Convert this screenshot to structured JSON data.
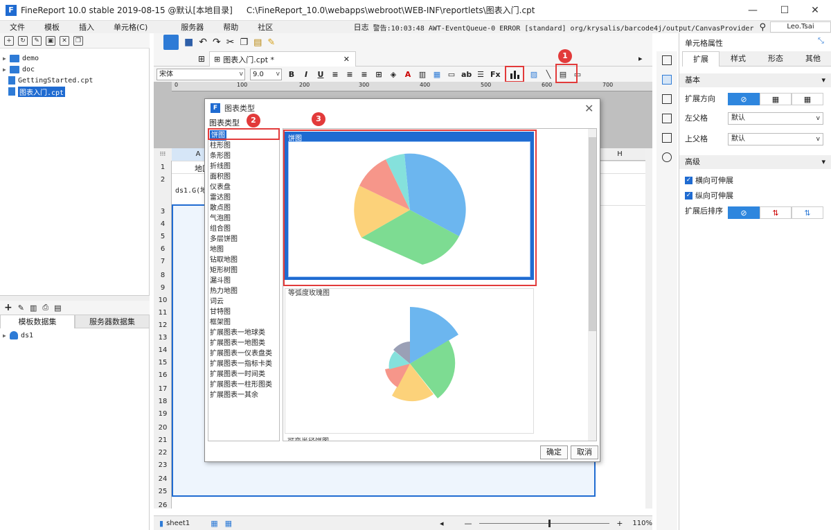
{
  "window": {
    "app_title": "FineReport 10.0 stable 2019-08-15 @默认[本地目录]",
    "path": "C:\\FineReport_10.0\\webapps\\webroot\\WEB-INF\\reportlets\\图表入门.cpt",
    "minimize": "—",
    "maximize": "☐",
    "close": "✕"
  },
  "menu": {
    "items": [
      "文件",
      "模板",
      "插入",
      "单元格(C)",
      "服务器",
      "帮助",
      "社区"
    ],
    "log_label": "日志",
    "warning": "警告:10:03:48 AWT-EventQueue-0 ERROR [standard] org/krysalis/barcode4j/output/CanvasProvider",
    "user": "Leo.Tsai"
  },
  "filetree": {
    "items": [
      {
        "label": "demo",
        "type": "folder"
      },
      {
        "label": "doc",
        "type": "folder"
      },
      {
        "label": "GettingStarted.cpt",
        "type": "file"
      },
      {
        "label": "图表入门.cpt",
        "type": "file",
        "selected": true
      }
    ]
  },
  "datasets": {
    "tabs": [
      "模板数据集",
      "服务器数据集"
    ],
    "items": [
      "ds1"
    ]
  },
  "doc_tab": {
    "label": "图表入门.cpt *",
    "close": "✕"
  },
  "format_bar": {
    "font": "宋体",
    "size": "9.0"
  },
  "ruler": {
    "ticks": [
      "0",
      "100",
      "200",
      "300",
      "400",
      "500",
      "600",
      "700"
    ]
  },
  "sheet": {
    "col_a": "A",
    "col_h": "H",
    "rows": [
      "1",
      "2",
      "3",
      "4",
      "5",
      "6",
      "7",
      "8",
      "9",
      "10",
      "11",
      "12",
      "13",
      "14",
      "15",
      "16",
      "17",
      "18",
      "19",
      "20",
      "21",
      "22",
      "23",
      "24",
      "25",
      "26"
    ],
    "cell_b1": "地区",
    "cell_a2": "ds1.G(地",
    "sheet_tab": "sheet1",
    "zoom": "110%"
  },
  "right_panel": {
    "title": "单元格属性",
    "tabs": [
      "扩展",
      "样式",
      "形态",
      "其他"
    ],
    "section_basic": "基本",
    "expand_dir": "扩展方向",
    "left_parent": "左父格",
    "left_parent_val": "默认",
    "up_parent": "上父格",
    "up_parent_val": "默认",
    "section_advanced": "高级",
    "h_expand": "横向可伸展",
    "v_expand": "纵向可伸展",
    "sort_after": "扩展后排序"
  },
  "dialog": {
    "title": "图表类型",
    "list_label": "图表类型",
    "types": [
      "饼图",
      "柱形图",
      "条形图",
      "折线图",
      "面积图",
      "仪表盘",
      "雷达图",
      "散点图",
      "气泡图",
      "组合图",
      "多层饼图",
      "地图",
      "钻取地图",
      "矩形树图",
      "漏斗图",
      "热力地图",
      "词云",
      "甘特图",
      "框架图",
      "扩展图表一地球类",
      "扩展图表一地图类",
      "扩展图表一仪表盘类",
      "扩展图表一指标卡类",
      "扩展图表一时间类",
      "扩展图表一柱形图类",
      "扩展图表一其余"
    ],
    "card1_label": "饼图",
    "card2_label": "等弧度玫瑰图",
    "card3_label": "可变半径饼图",
    "ok": "确定",
    "cancel": "取消"
  },
  "badges": [
    "1",
    "2",
    "3"
  ],
  "colors": {
    "accent": "#1f6bd1",
    "highlight_red": "#e23a3a",
    "pie_blue": "#5dade2",
    "pie_green": "#7ddc92",
    "pie_yellow": "#fcd27a",
    "pie_red": "#f48b7f",
    "pie_teal": "#7fe0e0"
  }
}
